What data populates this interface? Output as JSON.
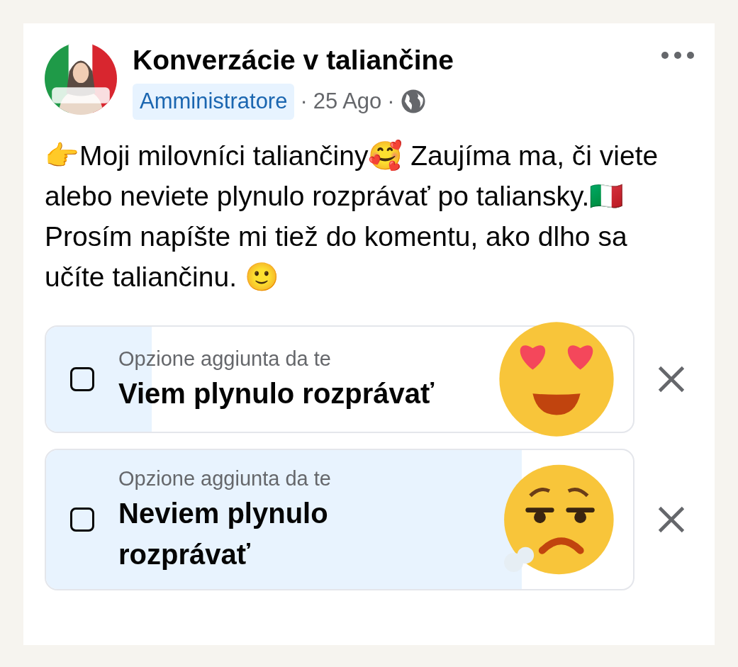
{
  "post": {
    "group_name": "Konverzácie v taliančine",
    "role_badge": "Amministratore",
    "date": "25 Ago",
    "separator_1": "·",
    "separator_2": "·",
    "paragraphs": [
      "👉Moji milovníci taliančiny🥰 Zaujíma ma, či viete alebo neviete plynulo rozprávať po taliansky.🇮🇹",
      "Prosím napíšte mi tiež do komentu, ako dlho sa učíte taliančinu. 🙂"
    ]
  },
  "poll": {
    "options": [
      {
        "caption": "Opzione aggiunta da te",
        "label": "Viem plynulo rozprávať",
        "checked": false,
        "level": 0.18,
        "kind": "love"
      },
      {
        "caption": "Opzione aggiunta da te",
        "label": "Neviem plynulo rozprávať",
        "checked": false,
        "level": 0.81,
        "kind": "sigh"
      }
    ]
  }
}
